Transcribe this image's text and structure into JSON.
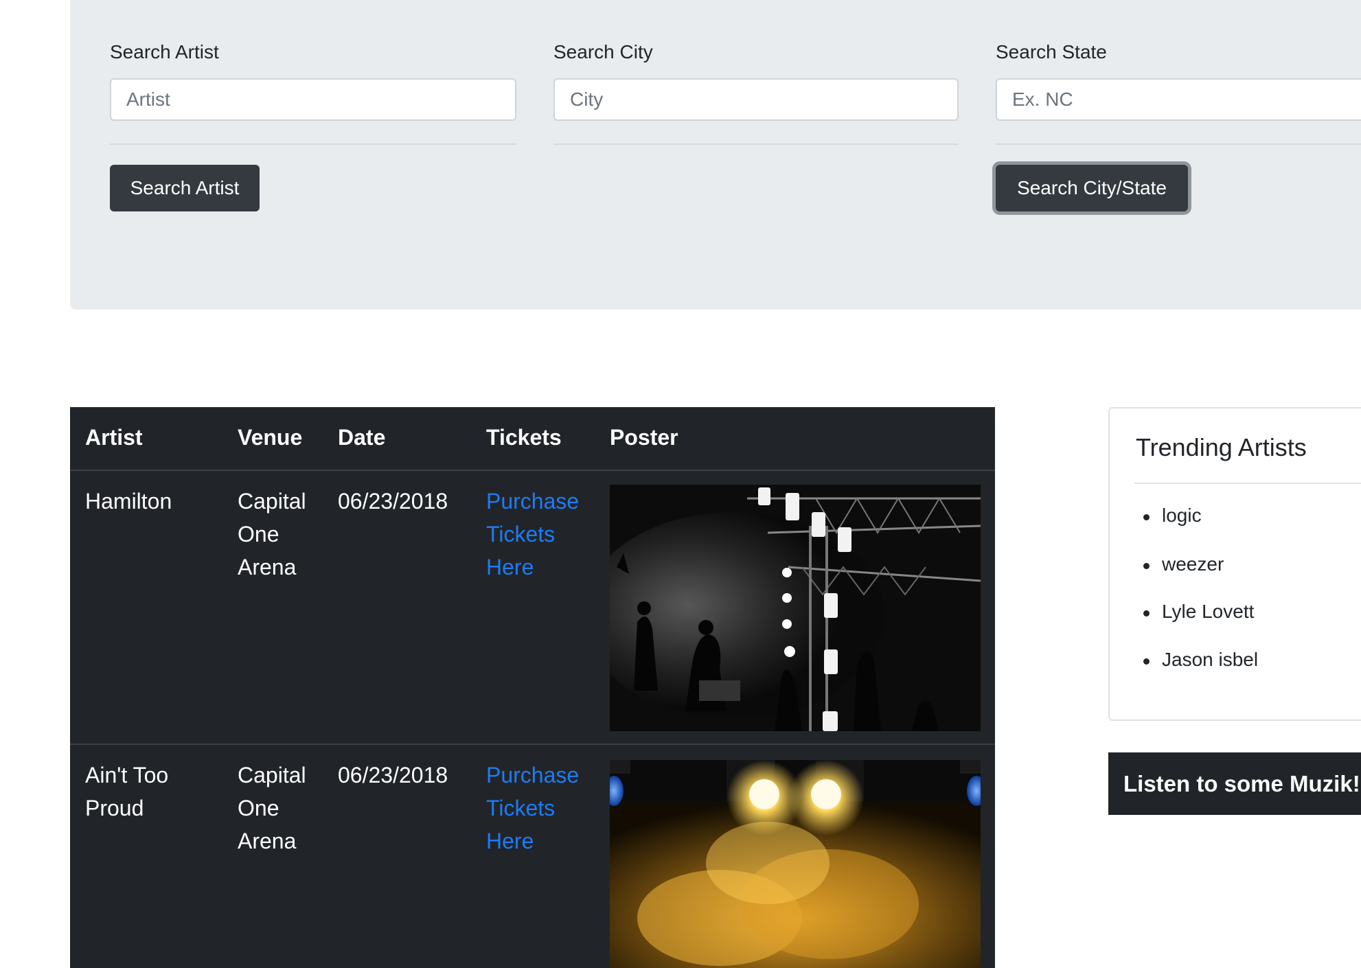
{
  "search": {
    "artist_label": "Search Artist",
    "artist_placeholder": "Artist",
    "city_label": "Search City",
    "city_placeholder": "City",
    "state_label": "Search State",
    "state_placeholder": "Ex. NC",
    "artist_button": "Search Artist",
    "city_state_button": "Search City/State"
  },
  "table": {
    "headers": [
      "Artist",
      "Venue",
      "Date",
      "Tickets",
      "Poster"
    ],
    "rows": [
      {
        "artist": "Hamilton",
        "venue": "Capital One Arena",
        "date": "06/23/2018",
        "tickets": "Purchase Tickets Here"
      },
      {
        "artist": "Ain't Too Proud",
        "venue": "Capital One Arena",
        "date": "06/23/2018",
        "tickets": "Purchase Tickets Here"
      }
    ]
  },
  "trending": {
    "title": "Trending Artists",
    "items": [
      "logic",
      "weezer",
      "Lyle Lovett",
      "Jason isbel"
    ]
  },
  "listen_label": "Listen to some Muzik!",
  "colors": {
    "jumbotron": "#e9ecef",
    "dark": "#212529",
    "button": "#343a40",
    "link": "#1e7bf5"
  }
}
